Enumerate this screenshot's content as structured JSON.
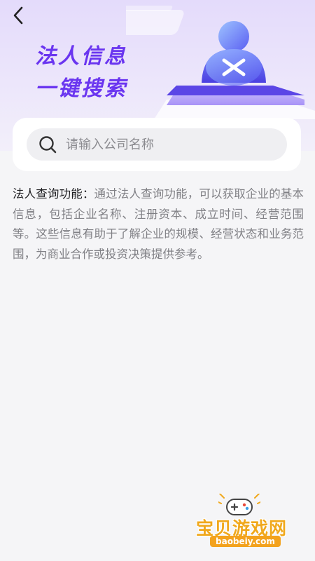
{
  "header": {
    "title_line1": "法人信息",
    "title_line2": "一键搜索"
  },
  "search": {
    "placeholder": "请输入公司名称",
    "value": ""
  },
  "description": {
    "label": "法人查询功能：",
    "text": "通过法人查询功能，可以获取企业的基本信息，包括企业名称、注册资本、成立时间、经营范围等。这些信息有助于了解企业的规模、经营状态和业务范围，为商业合作或投资决策提供参考。"
  },
  "watermark": {
    "name": "宝贝游戏网",
    "url": "baobeiy.com"
  },
  "icons": {
    "back": "chevron-left-icon",
    "search": "search-icon",
    "illustration": "user-search-illustration",
    "watermark_logo": "gamepad-icon"
  },
  "colors": {
    "accent": "#6a35f0",
    "hero_bg": "#e4dbfb",
    "page_bg": "#f5f5f7",
    "watermark": "#f0a81c"
  }
}
